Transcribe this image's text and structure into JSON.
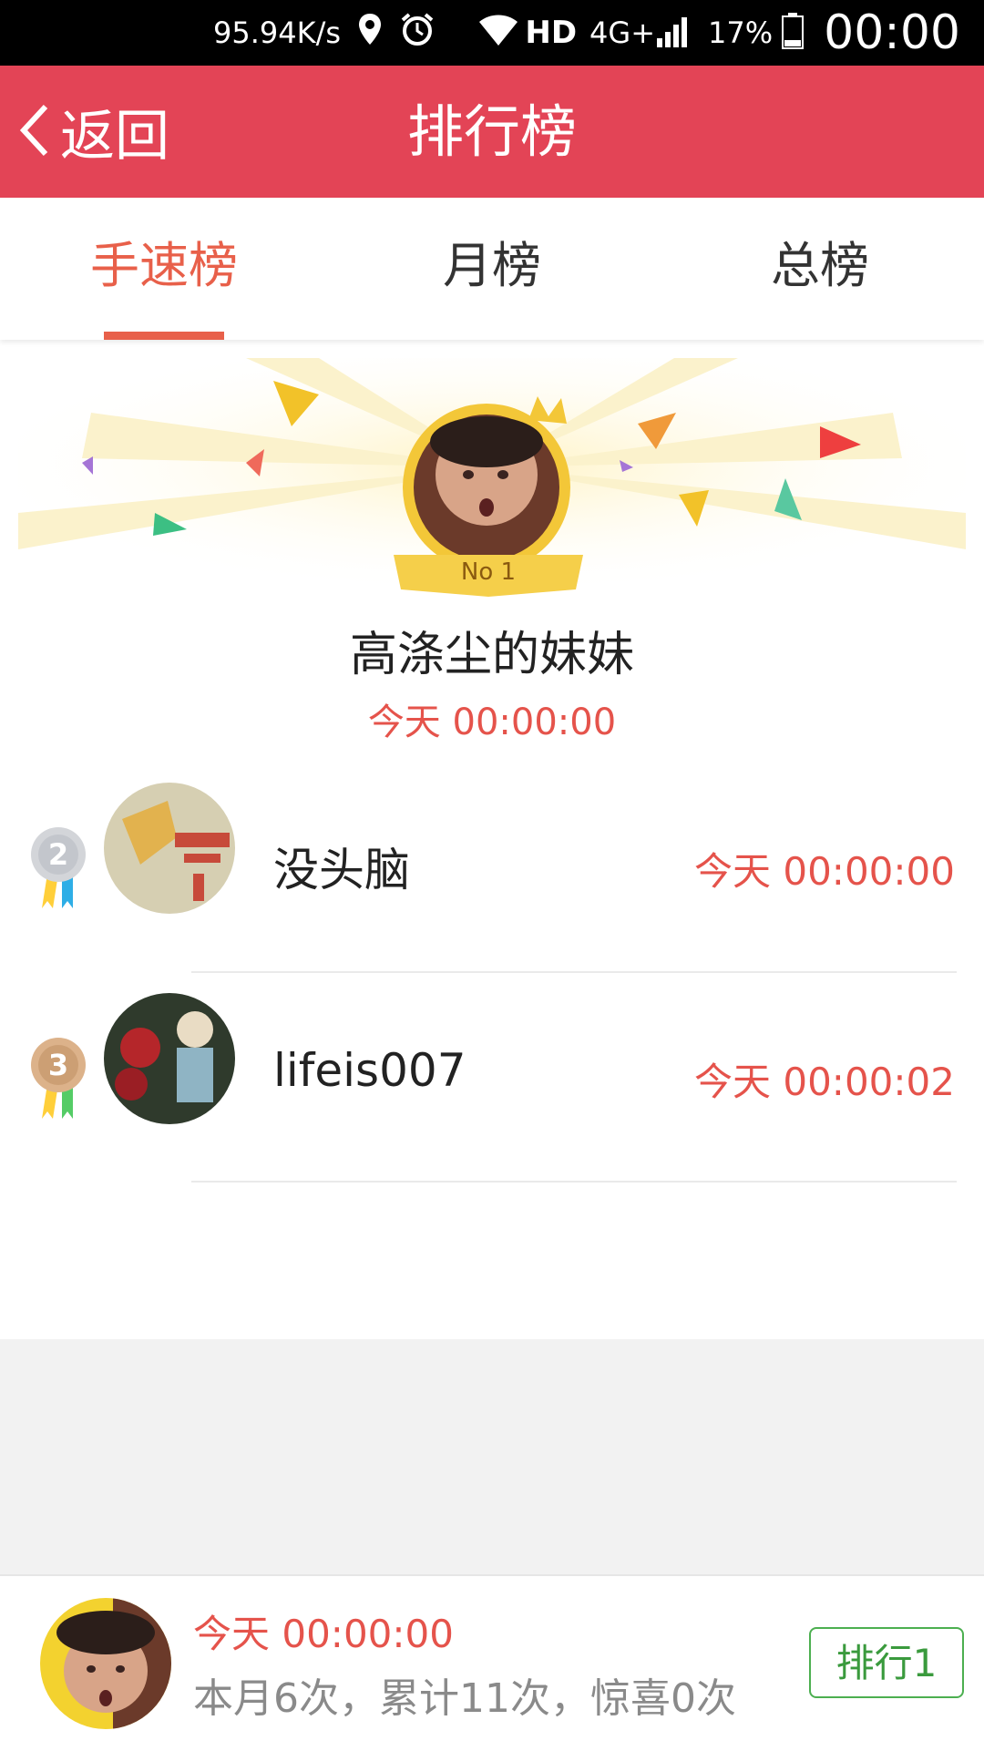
{
  "status_bar": {
    "net_speed": "95.94K/s",
    "hd": "HD",
    "network": "4G+",
    "battery": "17%",
    "time": "00:00",
    "icons": [
      "location-icon",
      "alarm-icon",
      "wifi-icon",
      "signal-icon",
      "battery-icon"
    ]
  },
  "header": {
    "back_label": "返回",
    "title": "排行榜",
    "color": "#e34456"
  },
  "tabs": [
    {
      "label": "手速榜",
      "active": true
    },
    {
      "label": "月榜",
      "active": false
    },
    {
      "label": "总榜",
      "active": false
    }
  ],
  "winner": {
    "badge": "No 1",
    "name": "高涤尘的妹妹",
    "time": "今天 00:00:00"
  },
  "ranking": [
    {
      "rank": "2",
      "name": "没头脑",
      "time": "今天 00:00:00"
    },
    {
      "rank": "3",
      "name": "lifeis007",
      "time": "今天 00:00:02"
    }
  ],
  "bottom": {
    "time": "今天 00:00:00",
    "stats": "本月6次，累计11次，惊喜0次",
    "rank_button": "排行1"
  },
  "colors": {
    "accent": "#e8604a",
    "time_red": "#e5534b",
    "button_green": "#4caf50"
  }
}
